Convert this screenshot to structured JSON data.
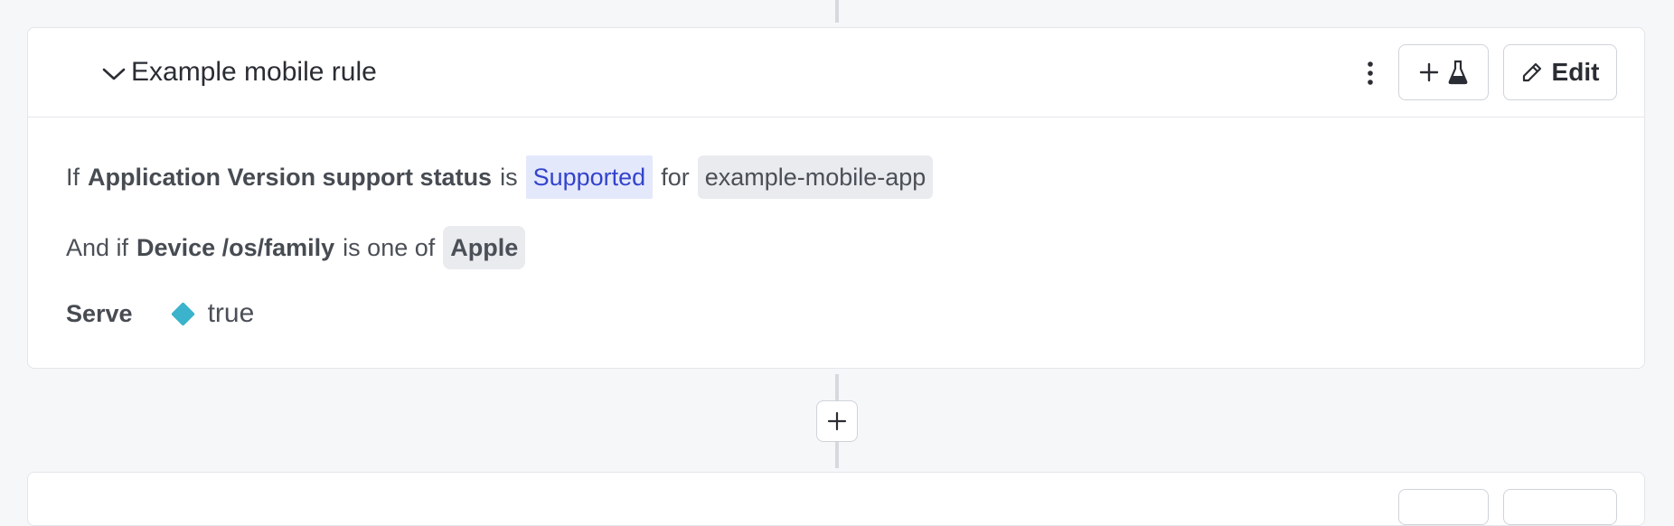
{
  "rule": {
    "title": "Example mobile rule",
    "edit_label": "Edit",
    "icons": {
      "collapse": "chevron-down-icon",
      "more": "kebab-icon",
      "add_experiment": [
        "plus-icon",
        "flask-icon"
      ],
      "edit": "pencil-icon"
    },
    "clause1": {
      "prefix": "If",
      "attribute": "Application Version support status",
      "operator": "is",
      "value": "Supported",
      "connector": "for",
      "target": "example-mobile-app"
    },
    "clause2": {
      "prefix": "And if",
      "attribute": "Device /os/family",
      "operator": "is one of",
      "value": "Apple"
    },
    "serve": {
      "label": "Serve",
      "value": "true",
      "variation_color": "#3bb3cc"
    }
  },
  "add_rule": {
    "icon": "plus-icon"
  }
}
